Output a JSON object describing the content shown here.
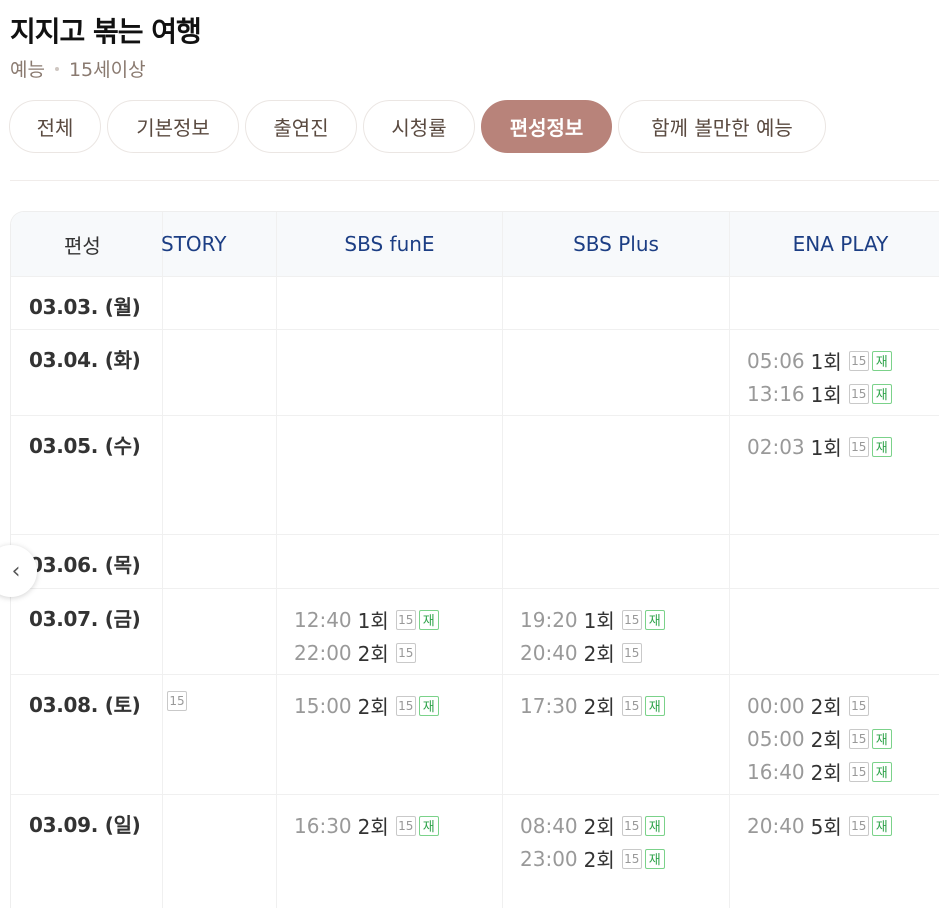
{
  "program": {
    "title": "지지고 볶는 여행",
    "genre": "예능",
    "rating": "15세이상"
  },
  "tabs": [
    {
      "label": "전체",
      "active": false
    },
    {
      "label": "기본정보",
      "active": false
    },
    {
      "label": "출연진",
      "active": false
    },
    {
      "label": "시청률",
      "active": false
    },
    {
      "label": "편성정보",
      "active": true
    },
    {
      "label": "함께 볼만한 예능",
      "active": false
    }
  ],
  "schedule": {
    "header_label": "편성",
    "channels": [
      "STORY",
      "SBS funE",
      "SBS Plus",
      "ENA PLAY"
    ],
    "rows": [
      {
        "date": "03.03. (월)",
        "cells": [
          [],
          [],
          [],
          []
        ]
      },
      {
        "date": "03.04. (화)",
        "cells": [
          [],
          [],
          [],
          [
            {
              "time": "05:06",
              "ep": "1회",
              "rating": "15",
              "re": "재"
            },
            {
              "time": "13:16",
              "ep": "1회",
              "rating": "15",
              "re": "재"
            }
          ]
        ]
      },
      {
        "date": "03.05. (수)",
        "cells": [
          [],
          [],
          [],
          [
            {
              "time": "02:03",
              "ep": "1회",
              "rating": "15",
              "re": "재"
            }
          ]
        ]
      },
      {
        "date": "03.06. (목)",
        "cells": [
          [],
          [],
          [],
          []
        ]
      },
      {
        "date": "03.07. (금)",
        "cells": [
          [],
          [
            {
              "time": "12:40",
              "ep": "1회",
              "rating": "15",
              "re": "재"
            },
            {
              "time": "22:00",
              "ep": "2회",
              "rating": "15",
              "re": ""
            }
          ],
          [
            {
              "time": "19:20",
              "ep": "1회",
              "rating": "15",
              "re": "재"
            },
            {
              "time": "20:40",
              "ep": "2회",
              "rating": "15",
              "re": ""
            }
          ],
          []
        ]
      },
      {
        "date": "03.08. (토)",
        "cells": [
          [
            {
              "time": "",
              "ep": "",
              "rating": "15",
              "re": ""
            }
          ],
          [
            {
              "time": "15:00",
              "ep": "2회",
              "rating": "15",
              "re": "재"
            }
          ],
          [
            {
              "time": "17:30",
              "ep": "2회",
              "rating": "15",
              "re": "재"
            }
          ],
          [
            {
              "time": "00:00",
              "ep": "2회",
              "rating": "15",
              "re": ""
            },
            {
              "time": "05:00",
              "ep": "2회",
              "rating": "15",
              "re": "재"
            },
            {
              "time": "16:40",
              "ep": "2회",
              "rating": "15",
              "re": "재"
            }
          ]
        ]
      },
      {
        "date": "03.09. (일)",
        "cells": [
          [],
          [
            {
              "time": "16:30",
              "ep": "2회",
              "rating": "15",
              "re": "재"
            }
          ],
          [
            {
              "time": "08:40",
              "ep": "2회",
              "rating": "15",
              "re": "재"
            },
            {
              "time": "23:00",
              "ep": "2회",
              "rating": "15",
              "re": "재"
            }
          ],
          [
            {
              "time": "20:40",
              "ep": "5회",
              "rating": "15",
              "re": "재"
            }
          ]
        ]
      }
    ]
  },
  "nav": {
    "prev_icon": "chevron-left-icon",
    "prev_glyph": "‹"
  }
}
